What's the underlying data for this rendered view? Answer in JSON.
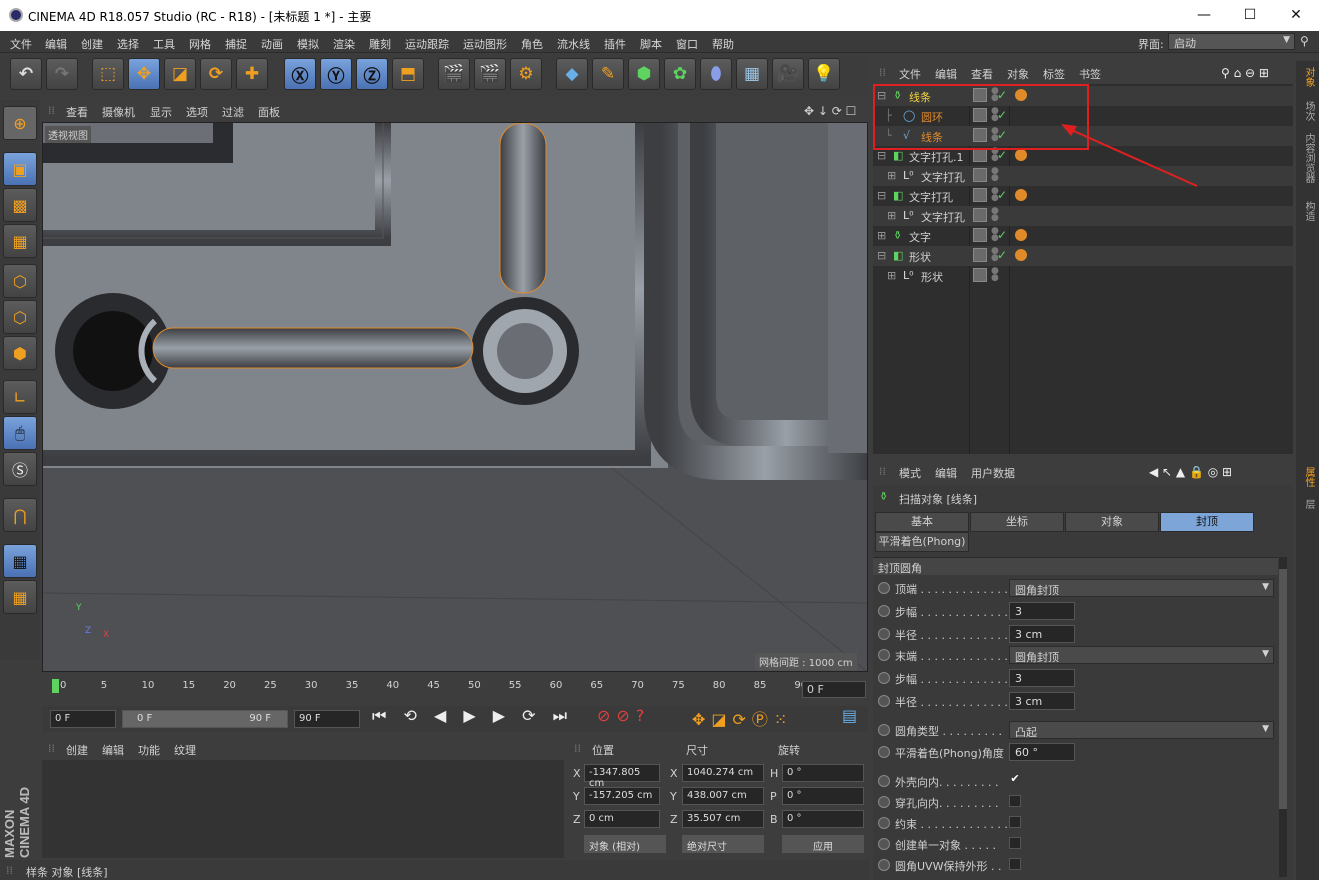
{
  "window": {
    "title": "CINEMA 4D R18.057 Studio (RC - R18) - [未标题 1 *] - 主要",
    "min": "—",
    "max": "☐",
    "close": "✕"
  },
  "menu": [
    "文件",
    "编辑",
    "创建",
    "选择",
    "工具",
    "网格",
    "捕捉",
    "动画",
    "模拟",
    "渲染",
    "雕刻",
    "运动跟踪",
    "运动图形",
    "角色",
    "流水线",
    "插件",
    "脚本",
    "窗口",
    "帮助"
  ],
  "layout": {
    "label": "界面:",
    "value": "启动"
  },
  "viewport": {
    "menu": [
      "查看",
      "摄像机",
      "显示",
      "选项",
      "过滤",
      "面板"
    ],
    "name": "透视视图",
    "grid": "网格间距 : 1000 cm",
    "axes": {
      "y": "Y",
      "x": "X",
      "z": "Z"
    }
  },
  "objects": {
    "menu": [
      "文件",
      "编辑",
      "查看",
      "对象",
      "标签",
      "书签"
    ],
    "rows": [
      {
        "name": "线条",
        "color": "#f2d23a"
      },
      {
        "name": "圆环",
        "color": "#e08a2a"
      },
      {
        "name": "线条",
        "color": "#e08a2a"
      },
      {
        "name": "文字打孔.1",
        "color": "#d0d0d0"
      },
      {
        "name": "文字打孔",
        "color": "#d0d0d0"
      },
      {
        "name": "文字打孔",
        "color": "#d0d0d0"
      },
      {
        "name": "文字打孔",
        "color": "#d0d0d0"
      },
      {
        "name": "文字",
        "color": "#d0d0d0"
      },
      {
        "name": "形状",
        "color": "#d0d0d0"
      },
      {
        "name": "形状",
        "color": "#d0d0d0"
      }
    ]
  },
  "right_tabs": [
    "对象",
    "场次",
    "内容浏览器",
    "构造"
  ],
  "right_tabs2": [
    "属性",
    "层"
  ],
  "attributes": {
    "menu": [
      "模式",
      "编辑",
      "用户数据"
    ],
    "title": "扫描对象 [线条]",
    "tabs": [
      "基本",
      "坐标",
      "对象",
      "封顶"
    ],
    "tab2": "平滑着色(Phong)",
    "section": "封顶圆角",
    "props": [
      {
        "label": "顶端 . . . . . . . . . . . . . .",
        "type": "dd",
        "value": "圆角封顶"
      },
      {
        "label": "步幅 . . . . . . . . . . . . . .",
        "type": "fld",
        "value": "3"
      },
      {
        "label": "半径 . . . . . . . . . . . . . .",
        "type": "fld",
        "value": "3 cm"
      },
      {
        "label": "末端 . . . . . . . . . . . . . .",
        "type": "dd",
        "value": "圆角封顶"
      },
      {
        "label": "步幅 . . . . . . . . . . . . . .",
        "type": "fld",
        "value": "3"
      },
      {
        "label": "半径 . . . . . . . . . . . . . .",
        "type": "fld",
        "value": "3 cm"
      },
      {
        "label": "圆角类型 . . . . . . . . .",
        "type": "dd",
        "value": "凸起"
      },
      {
        "label": "平滑着色(Phong)角度",
        "type": "fld",
        "value": "60 °"
      },
      {
        "label": "外壳向内. . . . . . . . .",
        "type": "cb",
        "value": "✔"
      },
      {
        "label": "穿孔向内. . . . . . . . .",
        "type": "cb",
        "value": ""
      },
      {
        "label": "约束 . . . . . . . . . . . . . .",
        "type": "cb",
        "value": ""
      },
      {
        "label": "创建单一对象 . . . . .",
        "type": "cb",
        "value": ""
      },
      {
        "label": "圆角UVW保持外形 . .",
        "type": "cb",
        "value": ""
      }
    ]
  },
  "timeline": {
    "ticks": [
      "0",
      "5",
      "10",
      "15",
      "20",
      "25",
      "30",
      "35",
      "40",
      "45",
      "50",
      "55",
      "60",
      "65",
      "70",
      "75",
      "80",
      "85",
      "90"
    ],
    "end": "0 F"
  },
  "transport": {
    "start": "0 F",
    "range_start": "0 F",
    "range_end": "90 F",
    "end": "90 F"
  },
  "materials": {
    "menu": [
      "创建",
      "编辑",
      "功能",
      "纹理"
    ]
  },
  "coords": {
    "headers": [
      "位置",
      "尺寸",
      "旋转"
    ],
    "pos": {
      "X": "-1347.805 cm",
      "Y": "-157.205 cm",
      "Z": "0 cm"
    },
    "size": {
      "X": "1040.274 cm",
      "Y": "438.007 cm",
      "Z": "35.507 cm"
    },
    "rot": {
      "H": "0 °",
      "P": "0 °",
      "B": "0 °"
    },
    "mode": "对象 (相对)",
    "sizemode": "绝对尺寸",
    "apply": "应用"
  },
  "status": "样条 对象 [线条]",
  "brand": "MAXON CINEMA 4D",
  "accent": "#7ea5d8"
}
